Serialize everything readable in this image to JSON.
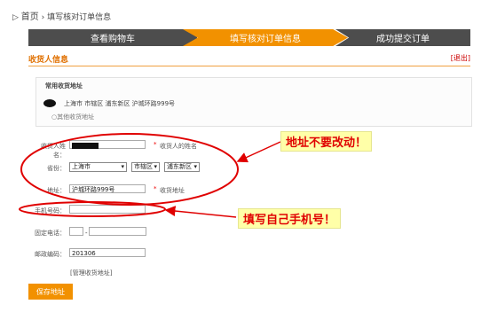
{
  "breadcrumb": {
    "home": "首页",
    "separator": "›",
    "current": "填写核对订单信息"
  },
  "steps": [
    {
      "label": "查看购物车"
    },
    {
      "label": "填写核对订单信息"
    },
    {
      "label": "成功提交订单"
    }
  ],
  "section": {
    "title": "收货人信息",
    "exit": "[退出]"
  },
  "saved": {
    "title": "常用收货地址",
    "address": "上海市 市辖区 浦东新区 沪城环路999号",
    "other": "○其他收货地址"
  },
  "form": {
    "name": {
      "label": "收货人姓名：",
      "hint": "收货人的姓名"
    },
    "region": {
      "label": "省份：",
      "province": "上海市",
      "city": "市辖区",
      "district": "浦东新区"
    },
    "address": {
      "label": "地址：",
      "value": "沪城环路999号",
      "hint": "收货地址"
    },
    "mobile": {
      "label": "手机号码："
    },
    "phone": {
      "label": "固定电话："
    },
    "postcode": {
      "label": "邮政编码：",
      "value": "201306"
    },
    "manage_link": "[管理收货地址]",
    "star": "*",
    "save_label": "保存地址"
  },
  "annotations": {
    "address_note": "地址不要改动！",
    "mobile_note": "填写自己手机号！",
    "color": "#e00000"
  }
}
